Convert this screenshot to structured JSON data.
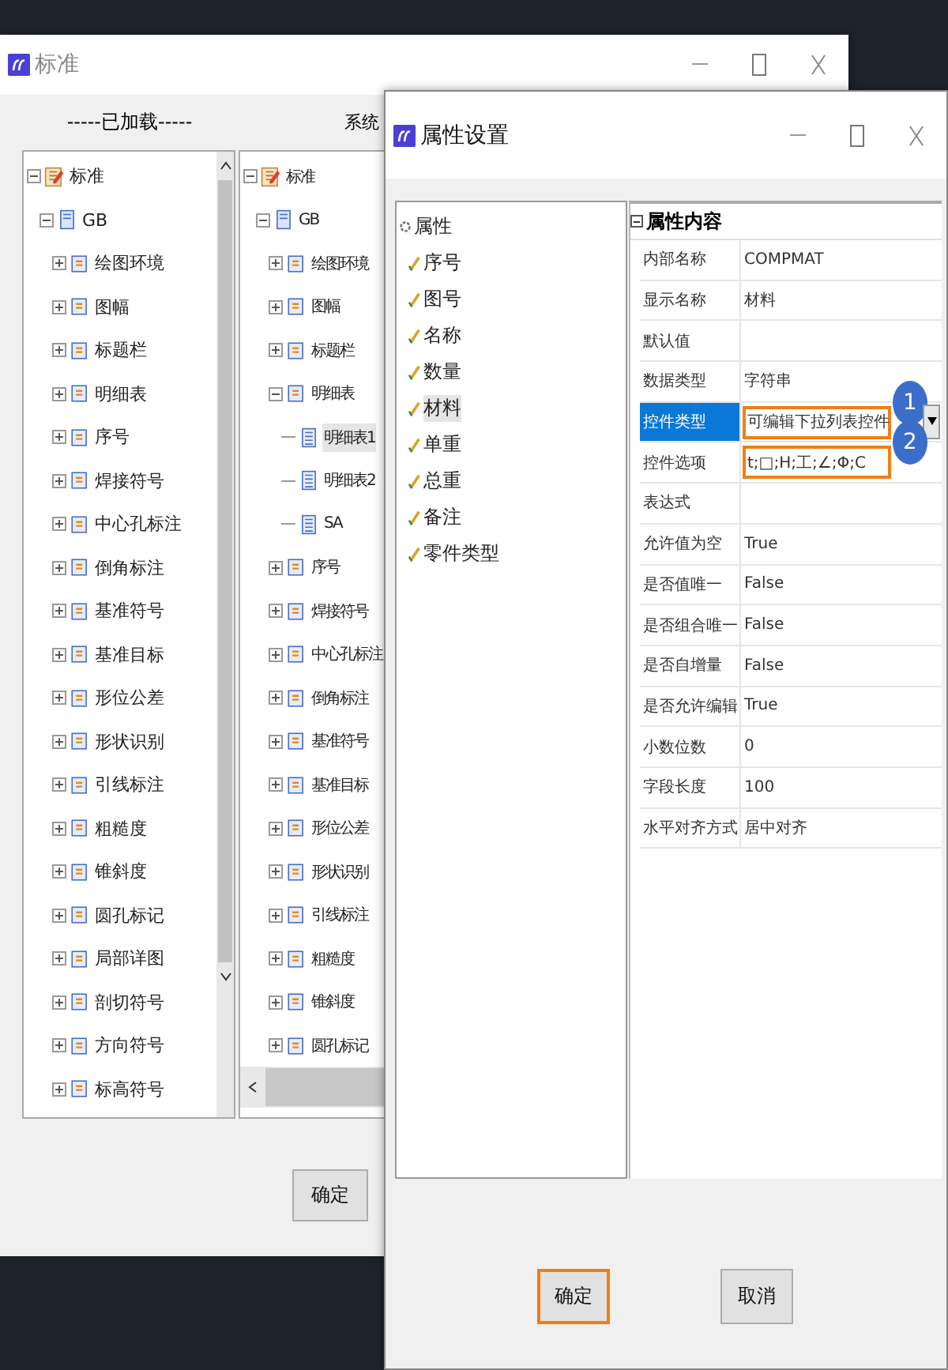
{
  "back_window": {
    "title": "标准",
    "loaded_header": "-----已加载-----",
    "system_header": "系统",
    "loaded_tree": [
      {
        "label": "标准",
        "kind": "library",
        "expanded": true,
        "children": [
          {
            "label": "GB",
            "kind": "standard",
            "expanded": true,
            "children": [
              {
                "label": "绘图环境",
                "kind": "category",
                "expanded": false
              },
              {
                "label": "图幅",
                "kind": "category",
                "expanded": false
              },
              {
                "label": "标题栏",
                "kind": "category",
                "expanded": false
              },
              {
                "label": "明细表",
                "kind": "category",
                "expanded": false
              },
              {
                "label": "序号",
                "kind": "category",
                "expanded": false
              },
              {
                "label": "焊接符号",
                "kind": "category",
                "expanded": false
              },
              {
                "label": "中心孔标注",
                "kind": "category",
                "expanded": false
              },
              {
                "label": "倒角标注",
                "kind": "category",
                "expanded": false
              },
              {
                "label": "基准符号",
                "kind": "category",
                "expanded": false
              },
              {
                "label": "基准目标",
                "kind": "category",
                "expanded": false
              },
              {
                "label": "形位公差",
                "kind": "category",
                "expanded": false
              },
              {
                "label": "形状识别",
                "kind": "category",
                "expanded": false
              },
              {
                "label": "引线标注",
                "kind": "category",
                "expanded": false
              },
              {
                "label": "粗糙度",
                "kind": "category",
                "expanded": false
              },
              {
                "label": "锥斜度",
                "kind": "category",
                "expanded": false
              },
              {
                "label": "圆孔标记",
                "kind": "category",
                "expanded": false
              },
              {
                "label": "局部详图",
                "kind": "category",
                "expanded": false
              },
              {
                "label": "剖切符号",
                "kind": "category",
                "expanded": false
              },
              {
                "label": "方向符号",
                "kind": "category",
                "expanded": false
              },
              {
                "label": "标高符号",
                "kind": "category",
                "expanded": false
              }
            ]
          }
        ]
      }
    ],
    "system_tree": [
      {
        "label": "标准",
        "kind": "library",
        "expanded": true,
        "children": [
          {
            "label": "GB",
            "kind": "standard",
            "expanded": true,
            "children": [
              {
                "label": "绘图环境",
                "kind": "category",
                "expanded": false
              },
              {
                "label": "图幅",
                "kind": "category",
                "expanded": false
              },
              {
                "label": "标题栏",
                "kind": "category",
                "expanded": false
              },
              {
                "label": "明细表",
                "kind": "category",
                "expanded": true,
                "children": [
                  {
                    "label": "明细表1",
                    "kind": "table",
                    "selected": true
                  },
                  {
                    "label": "明细表2",
                    "kind": "table",
                    "selected": false
                  },
                  {
                    "label": "SA",
                    "kind": "table",
                    "selected": false
                  }
                ]
              },
              {
                "label": "序号",
                "kind": "category",
                "expanded": false
              },
              {
                "label": "焊接符号",
                "kind": "category",
                "expanded": false
              },
              {
                "label": "中心孔标注",
                "kind": "category",
                "expanded": false
              },
              {
                "label": "倒角标注",
                "kind": "category",
                "expanded": false
              },
              {
                "label": "基准符号",
                "kind": "category",
                "expanded": false
              },
              {
                "label": "基准目标",
                "kind": "category",
                "expanded": false
              },
              {
                "label": "形位公差",
                "kind": "category",
                "expanded": false
              },
              {
                "label": "形状识别",
                "kind": "category",
                "expanded": false
              },
              {
                "label": "引线标注",
                "kind": "category",
                "expanded": false
              },
              {
                "label": "粗糙度",
                "kind": "category",
                "expanded": false
              },
              {
                "label": "锥斜度",
                "kind": "category",
                "expanded": false
              },
              {
                "label": "圆孔标记",
                "kind": "category",
                "expanded": false
              }
            ]
          }
        ]
      }
    ],
    "confirm_button": "确定"
  },
  "property_window": {
    "title": "属性设置",
    "attribute_tree": {
      "label": "属性",
      "items": [
        {
          "label": "序号",
          "selected": false
        },
        {
          "label": "图号",
          "selected": false
        },
        {
          "label": "名称",
          "selected": false
        },
        {
          "label": "数量",
          "selected": false
        },
        {
          "label": "材料",
          "selected": true
        },
        {
          "label": "单重",
          "selected": false
        },
        {
          "label": "总重",
          "selected": false
        },
        {
          "label": "备注",
          "selected": false
        },
        {
          "label": "零件类型",
          "selected": false
        }
      ]
    },
    "grid": {
      "header": "属性内容",
      "expanded": true,
      "rows": [
        {
          "name": "内部名称",
          "value": "COMPMAT",
          "selected": false,
          "outlined": false
        },
        {
          "name": "显示名称",
          "value": "材料",
          "selected": false,
          "outlined": false
        },
        {
          "name": "默认值",
          "selected": false,
          "outlined": false
        },
        {
          "name": "数据类型",
          "value": "字符串",
          "selected": false,
          "outlined": false
        },
        {
          "name": "控件类型",
          "value": "可编辑下拉列表控件",
          "selected": true,
          "outlined": true,
          "callout": "1"
        },
        {
          "name": "控件选项",
          "value": "t;□;H;工;∠;Φ;C",
          "selected": false,
          "outlined": true,
          "callout": "2"
        },
        {
          "name": "表达式",
          "selected": false,
          "outlined": false
        },
        {
          "name": "允许值为空",
          "value": "True",
          "selected": false,
          "outlined": false
        },
        {
          "name": "是否值唯一",
          "value": "False",
          "selected": false,
          "outlined": false
        },
        {
          "name": "是否组合唯一",
          "value": "False",
          "selected": false,
          "outlined": false
        },
        {
          "name": "是否自增量",
          "value": "False",
          "selected": false,
          "outlined": false
        },
        {
          "name": "是否允许编辑",
          "value": "True",
          "selected": false,
          "outlined": false
        },
        {
          "name": "小数位数",
          "value": "0",
          "selected": false,
          "outlined": false
        },
        {
          "name": "字段长度",
          "value": "100",
          "selected": false,
          "outlined": false
        },
        {
          "name": "水平对齐方式",
          "value": "居中对齐",
          "selected": false,
          "outlined": false
        }
      ]
    },
    "buttons": [
      {
        "label": "确定",
        "outlined": true
      },
      {
        "label": "取消",
        "outlined": false
      }
    ]
  }
}
